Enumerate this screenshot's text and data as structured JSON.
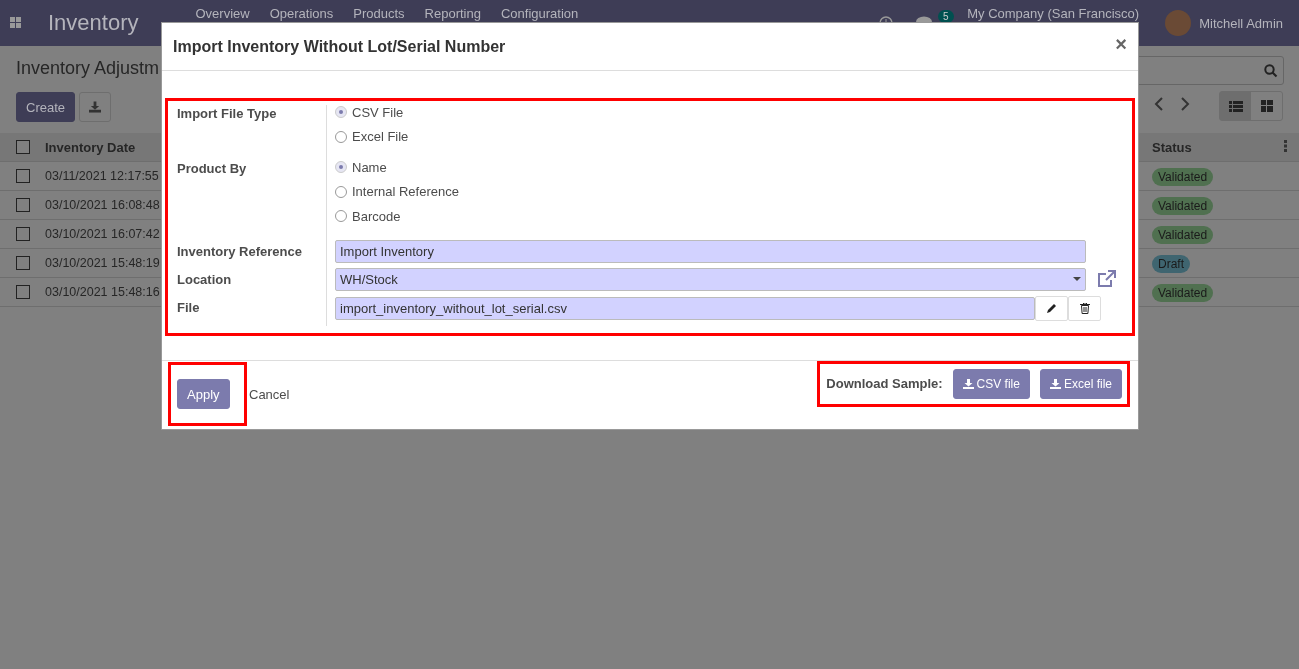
{
  "navbar": {
    "app_title": "Inventory",
    "menu": [
      "Overview",
      "Operations",
      "Products",
      "Reporting",
      "Configuration"
    ],
    "message_count": "5",
    "company": "My Company (San Francisco)",
    "user": "Mitchell Admin"
  },
  "control_panel": {
    "breadcrumb": "Inventory Adjustm",
    "create_button": "Create"
  },
  "table": {
    "select_all_checked": false,
    "columns": [
      "Inventory Date",
      "Status"
    ],
    "rows": [
      {
        "checked": false,
        "date": "03/11/2021 12:17:55",
        "status": "Validated",
        "kind": "done"
      },
      {
        "checked": false,
        "date": "03/10/2021 16:08:48",
        "status": "Validated",
        "kind": "done"
      },
      {
        "checked": false,
        "date": "03/10/2021 16:07:42",
        "status": "Validated",
        "kind": "done"
      },
      {
        "checked": false,
        "date": "03/10/2021 15:48:19",
        "status": "Draft",
        "kind": "draft"
      },
      {
        "checked": false,
        "date": "03/10/2021 15:48:16",
        "status": "Validated",
        "kind": "done"
      }
    ]
  },
  "dialog": {
    "title": "Import Inventory Without Lot/Serial Number",
    "close": "×",
    "fields": [
      {
        "kind": "radio",
        "label": "Import File Type",
        "options": [
          {
            "label": "CSV File",
            "selected": true
          },
          {
            "label": "Excel File",
            "selected": false
          }
        ]
      },
      {
        "kind": "radio",
        "label": "Product By",
        "options": [
          {
            "label": "Name",
            "selected": true
          },
          {
            "label": "Internal Reference",
            "selected": false
          },
          {
            "label": "Barcode",
            "selected": false
          }
        ]
      },
      {
        "kind": "text",
        "label": "Inventory Reference",
        "value": "Import Inventory"
      },
      {
        "kind": "select",
        "label": "Location",
        "value": "WH/Stock"
      },
      {
        "kind": "file",
        "label": "File",
        "value": "import_inventory_without_lot_serial.csv"
      }
    ],
    "apply": "Apply",
    "cancel": "Cancel",
    "download_label": "Download Sample:",
    "download_buttons": [
      "CSV file",
      "Excel file"
    ]
  }
}
